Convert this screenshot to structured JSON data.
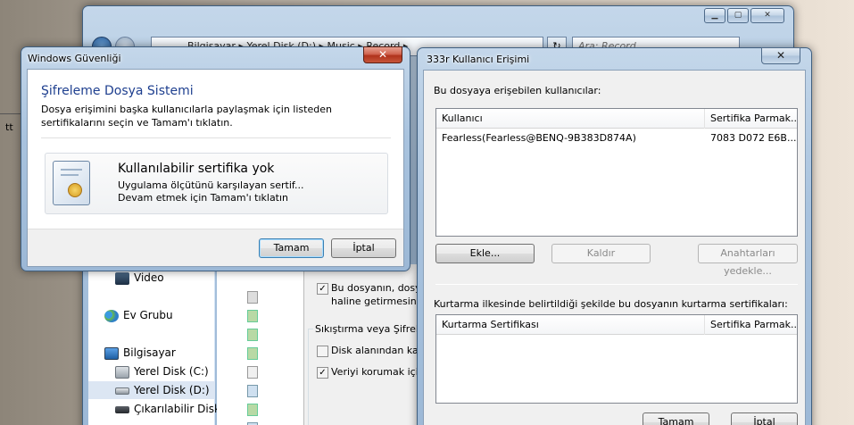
{
  "background_window": {
    "breadcrumb": [
      "Bilgisayar",
      "Yerel Disk (D:)",
      "Music",
      "Record"
    ],
    "search_placeholder": "Ara: Record",
    "nav": [
      {
        "label": "Video",
        "icon": "video-icon"
      },
      {
        "label": "Ev Grubu",
        "icon": "homegroup-icon"
      },
      {
        "label": "Bilgisayar",
        "icon": "computer-icon"
      },
      {
        "label": "Yerel Disk (C:)",
        "icon": "drive-icon"
      },
      {
        "label": "Yerel Disk (D:)",
        "icon": "drive-icon"
      },
      {
        "label": "Çıkarılabilir Disk (",
        "icon": "removable-drive-icon"
      }
    ],
    "side_text": "tt"
  },
  "attributes_dialog": {
    "opt1_line1": "Bu dosyanın, dosya e",
    "opt1_line2": "haline getirmesine izi",
    "group_title": "Sıkıştırma veya Şifreleme",
    "compress": "Disk alanından kazan",
    "encrypt": "Veriyi korumak için iç"
  },
  "security_dialog": {
    "title": "Windows Güvenliği",
    "close_glyph": "✕",
    "heading": "Şifreleme Dosya Sistemi",
    "description": "Dosya erişimini başka kullanıcılarla paylaşmak için listeden sertifikalarını seçin ve Tamam'ı tıklatın.",
    "cert_title": "Kullanılabilir sertifika yok",
    "cert_line1": "Uygulama ölçütünü karşılayan sertif...",
    "cert_line2": "Devam etmek için Tamam'ı tıklatın",
    "ok": "Tamam",
    "cancel": "İptal"
  },
  "access_dialog": {
    "title": "333r Kullanıcı Erişimi",
    "close_glyph": "✕",
    "users_label": "Bu dosyaya erişebilen kullanıcılar:",
    "users_columns": [
      "Kullanıcı",
      "Sertifika Parmak..."
    ],
    "users_rows": [
      {
        "user": "Fearless(Fearless@BENQ-9B383D874A)",
        "cert": "7083 D072 E6B..."
      }
    ],
    "add": "Ekle...",
    "remove": "Kaldır",
    "backup": "Anahtarları yedekle...",
    "recovery_label": "Kurtarma ilkesinde belirtildiği şekilde bu dosyanın kurtarma sertifikaları:",
    "recovery_columns": [
      "Kurtarma Sertifikası",
      "Sertifika Parmak..."
    ],
    "ok": "Tamam",
    "cancel": "İptal"
  }
}
